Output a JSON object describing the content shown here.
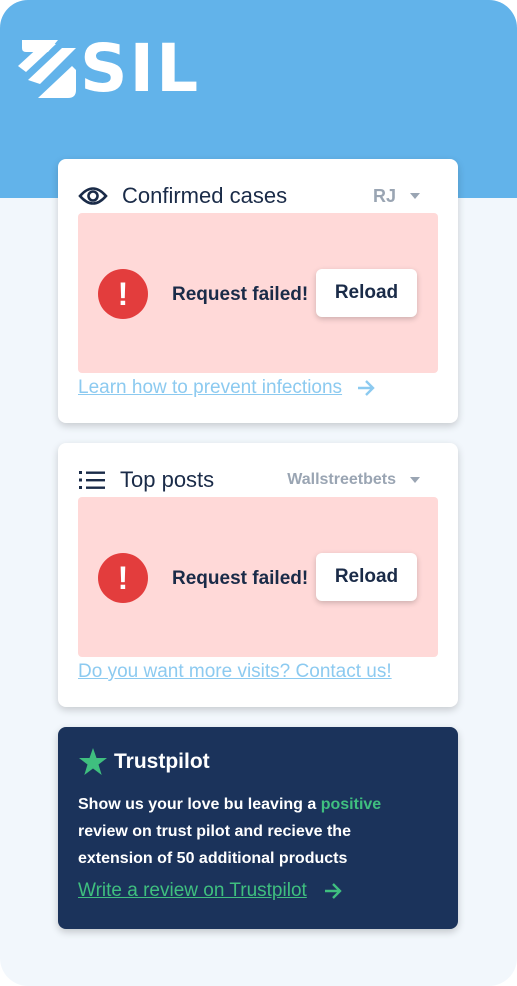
{
  "brand": {
    "logo_text": "SIL",
    "header_color": "#62b3ea"
  },
  "cases_card": {
    "title": "Confirmed cases",
    "icon": "eye-icon",
    "region_value": "RJ",
    "error_text": "Request failed!",
    "reload_label": "Reload",
    "link_text": "Learn how to prevent infections"
  },
  "posts_card": {
    "title": "Top posts",
    "icon": "list-icon",
    "source_value": "Wallstreetbets",
    "error_text": "Request failed!",
    "reload_label": "Reload",
    "link_text": "Do you want more visits? Contact us!"
  },
  "trustpilot": {
    "title": "Trustpilot",
    "body_before": "Show us your love bu leaving a ",
    "body_highlight": "positive",
    "body_after": " review on trust pilot and recieve the extension of 50 additional products",
    "link_text": "Write a review on Trustpilot",
    "accent": "#3fbf7f",
    "background": "#1b335b"
  },
  "colors": {
    "error_bg": "#ffd9d8",
    "error_icon": "#e33d3d",
    "link": "#8ccaf0",
    "text_dark": "#1a2b48"
  }
}
